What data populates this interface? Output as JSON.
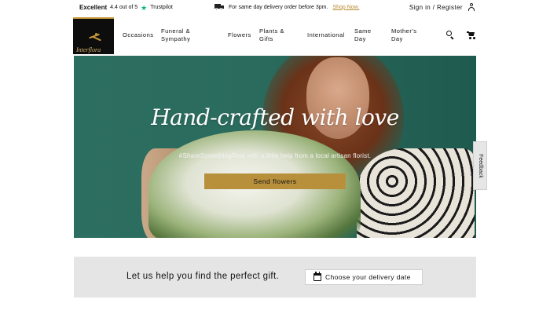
{
  "topbar": {
    "trustpilot": {
      "excellent": "Excellent",
      "rating": "4.4 out of 5",
      "brand": "Trustpilot"
    },
    "delivery": {
      "text": "For same day delivery order before 3pm.",
      "link": "Shop Now."
    },
    "account": "Sign in / Register"
  },
  "logo": {
    "text": "Interflora"
  },
  "nav": {
    "items": [
      {
        "label": "Occasions"
      },
      {
        "label": "Funeral &\nSympathy"
      },
      {
        "label": "Flowers"
      },
      {
        "label": "Plants &\nGifts"
      },
      {
        "label": "International"
      },
      {
        "label": "Same\nDay"
      },
      {
        "label": "Mother's\nDay"
      }
    ]
  },
  "hero": {
    "title": "Hand-crafted with love",
    "subtitle": "#ShareSomethingReal with a little help from a local artisan florist.",
    "button": "Send flowers"
  },
  "feedback": {
    "label": "Feedback"
  },
  "gift_finder": {
    "text": "Let us help you find the perfect gift.",
    "button": "Choose your delivery date"
  },
  "colors": {
    "accent": "#b8903c",
    "trustpilot_green": "#00b67a",
    "hero_bg": "#2c6e60",
    "panel_bg": "#e5e5e5"
  },
  "icons": [
    "truck-icon",
    "user-icon",
    "search-icon",
    "cart-icon",
    "calendar-icon",
    "star-icon"
  ]
}
